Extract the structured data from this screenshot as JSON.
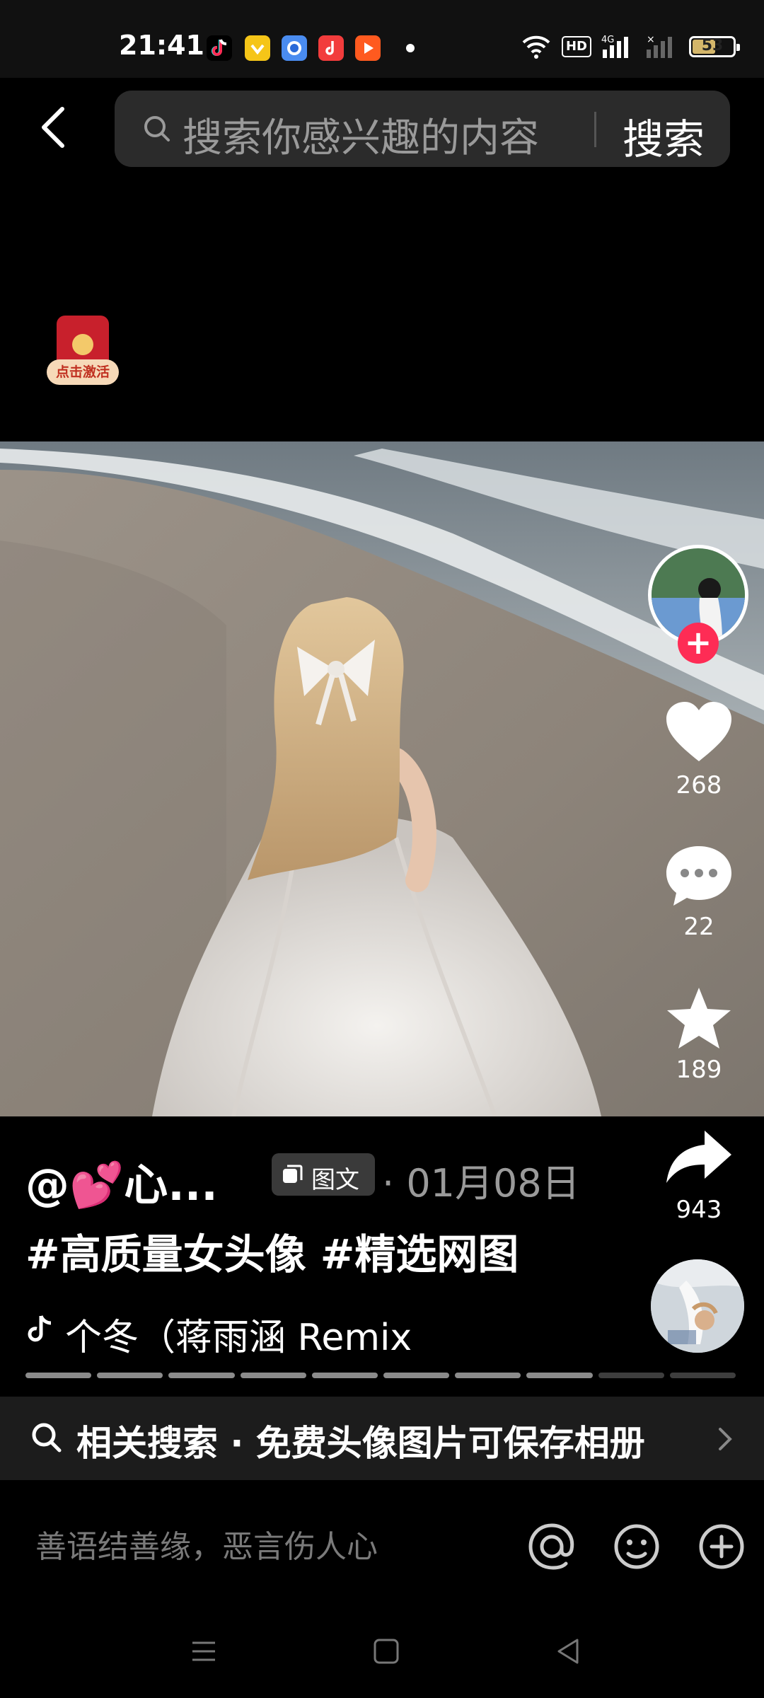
{
  "status_bar": {
    "time": "21:41",
    "network_badge": "HD",
    "network_type": "4G",
    "battery": "53"
  },
  "header": {
    "search_placeholder": "搜索你感兴趣的内容",
    "search_button": "搜索"
  },
  "promo_badge": {
    "label": "点击激活"
  },
  "post": {
    "author": "@💕心...",
    "type_label": "图文",
    "date": "· 01月08日",
    "hashtags": "#高质量女头像 #精选网图",
    "music": "个冬（蒋雨涵 Remix"
  },
  "actions": {
    "likes": "268",
    "comments": "22",
    "favorites": "189",
    "shares": "943"
  },
  "carousel": {
    "total": 10,
    "current": 8
  },
  "related_search": {
    "text": "相关搜索 · 免费头像图片可保存相册"
  },
  "comment_bar": {
    "placeholder": "善语结善缘，恶言伤人心"
  },
  "colors": {
    "accent": "#fe2c55",
    "background": "#000000"
  }
}
